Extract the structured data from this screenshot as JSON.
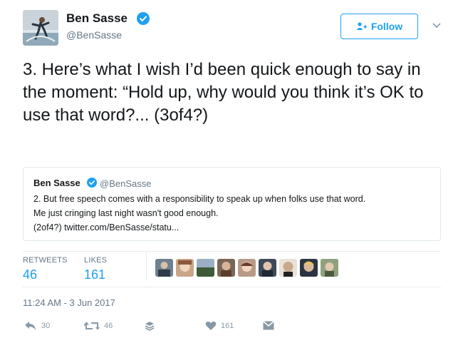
{
  "header": {
    "display_name": "Ben Sasse",
    "handle": "@BenSasse",
    "follow_label": "Follow"
  },
  "tweet": {
    "text": "3. Here’s what I wish I’d been quick enough to say in the moment: “Hold up, why would you think it’s OK to use that word?... (3of4?)"
  },
  "quoted_tweet": {
    "display_name": "Ben Sasse",
    "handle": "@BenSasse",
    "text_line1": "2. But free speech comes with a responsibility to speak up when folks use that word.",
    "text_line2": "Me just cringing last night wasn't good enough.",
    "text_line3": "(2of4?) twitter.com/BenSasse/statu..."
  },
  "stats": {
    "retweets_label": "RETWEETS",
    "retweets_value": "46",
    "likes_label": "LIKES",
    "likes_value": "161"
  },
  "timestamp": "11:24 AM - 3 Jun 2017",
  "actions": {
    "reply_count": "30",
    "retweet_count": "46",
    "like_count": "161"
  },
  "colors": {
    "accent": "#1da1f2",
    "muted": "#657786",
    "verified": "#1da1f2",
    "text": "#14171a",
    "border": "#e1e8ed"
  },
  "icons": [
    "verified-badge-icon",
    "add-user-icon",
    "chevron-down-icon",
    "reply-icon",
    "retweet-icon",
    "buffer-stack-icon",
    "heart-icon",
    "message-icon"
  ]
}
